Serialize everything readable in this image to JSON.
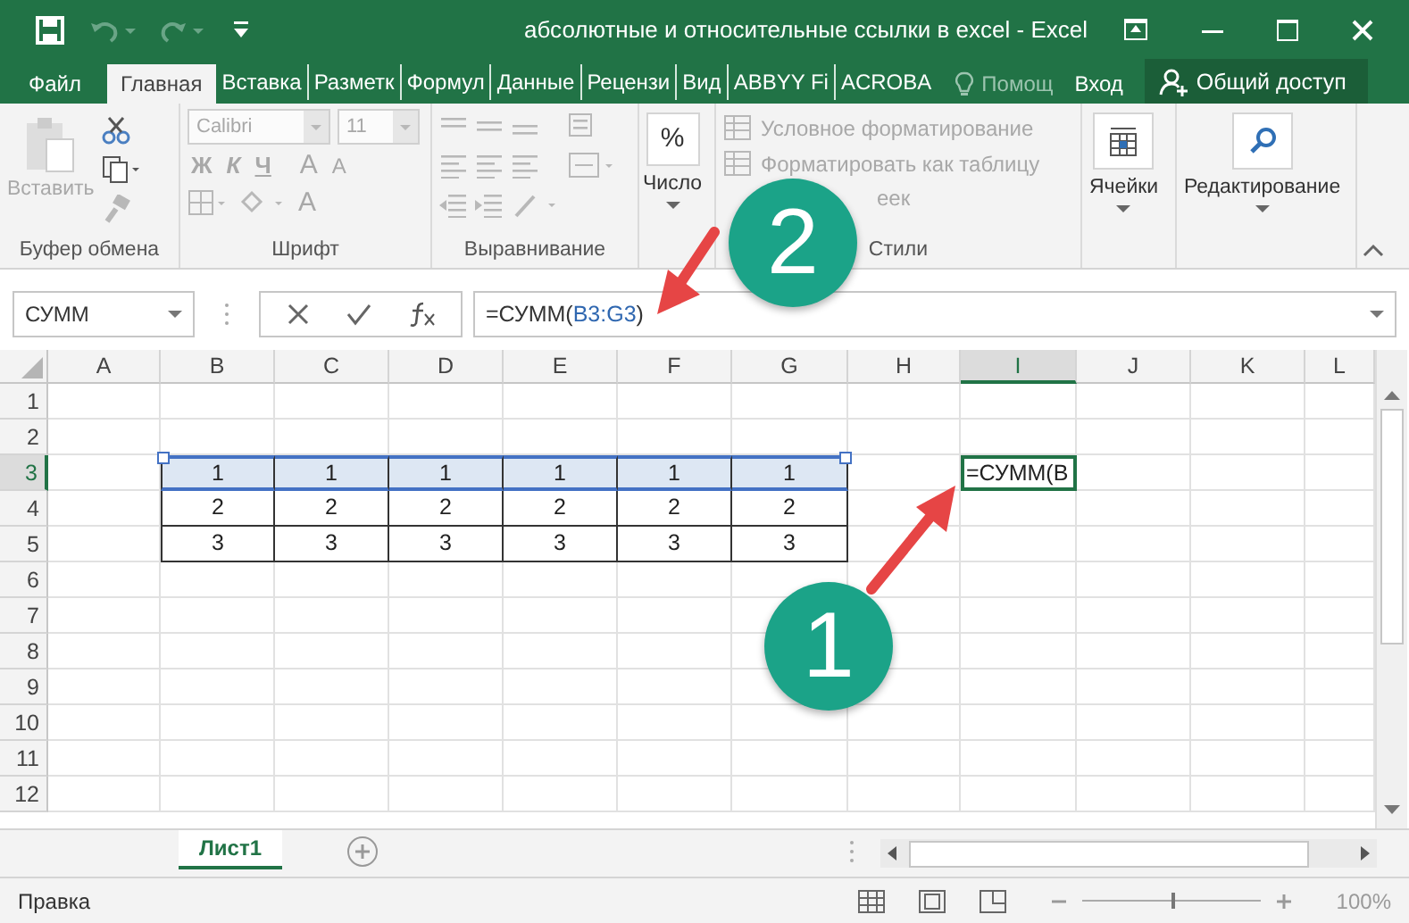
{
  "window": {
    "title": "абсолютные и относительные ссылки в excel - Excel"
  },
  "tabs": [
    {
      "label": "Файл",
      "selected": false
    },
    {
      "label": "Главная",
      "selected": true
    },
    {
      "label": "Вставка",
      "selected": false
    },
    {
      "label": "Разметк",
      "selected": false
    },
    {
      "label": "Формул",
      "selected": false
    },
    {
      "label": "Данные",
      "selected": false
    },
    {
      "label": "Рецензи",
      "selected": false
    },
    {
      "label": "Вид",
      "selected": false
    },
    {
      "label": "ABBYY Fi",
      "selected": false
    },
    {
      "label": "ACROBA",
      "selected": false
    }
  ],
  "tell_me": "Помощ",
  "sign_in": "Вход",
  "share": "Общий доступ",
  "ribbon": [
    {
      "kind": "clipboard",
      "label": "Буфер обмена",
      "button": "Вставить",
      "disabled": true
    },
    {
      "kind": "font",
      "label": "Шрифт",
      "font": "Calibri",
      "size": "11",
      "styles": [
        "Ж",
        "К",
        "Ч"
      ],
      "grow": "A",
      "shrink": "A",
      "font_color_letter": "A",
      "disabled": true
    },
    {
      "kind": "alignment",
      "label": "Выравнивание",
      "disabled": true
    },
    {
      "kind": "number",
      "symbol": "%",
      "button": "Число",
      "disabled": false
    },
    {
      "kind": "styles",
      "label": "Стили",
      "commands": [
        "Условное форматирование",
        "Форматировать как таблицу",
        "еек"
      ],
      "disabled": true
    },
    {
      "kind": "cells",
      "button": "Ячейки",
      "disabled": false
    },
    {
      "kind": "editing",
      "button": "Редактирование",
      "disabled": false
    }
  ],
  "formula_bar": {
    "name_box": "СУММ",
    "formula": [
      {
        "kind": "plain",
        "text": "=СУММ("
      },
      {
        "kind": "ref",
        "text": "B3:G3"
      },
      {
        "kind": "plain",
        "text": ")"
      }
    ]
  },
  "columns": [
    {
      "label": "A",
      "selected": false
    },
    {
      "label": "B",
      "selected": false
    },
    {
      "label": "C",
      "selected": false
    },
    {
      "label": "D",
      "selected": false
    },
    {
      "label": "E",
      "selected": false
    },
    {
      "label": "F",
      "selected": false
    },
    {
      "label": "G",
      "selected": false
    },
    {
      "label": "H",
      "selected": false
    },
    {
      "label": "I",
      "selected": true
    },
    {
      "label": "J",
      "selected": false
    },
    {
      "label": "K",
      "selected": false
    },
    {
      "label": "L",
      "selected": false
    }
  ],
  "rows": [
    {
      "header": "1",
      "selected": false
    },
    {
      "header": "2",
      "selected": false
    },
    {
      "header": "3",
      "selected": true,
      "cells": [
        {},
        {
          "value": "1",
          "bordered": true,
          "selected": true
        },
        {
          "value": "1",
          "bordered": true,
          "selected": true
        },
        {
          "value": "1",
          "bordered": true,
          "selected": true
        },
        {
          "value": "1",
          "bordered": true,
          "selected": true
        },
        {
          "value": "1",
          "bordered": true,
          "selected": true
        },
        {
          "value": "1",
          "bordered": true,
          "selected": true
        },
        {},
        {
          "value": "=СУММ(B",
          "editing": true
        },
        {},
        {},
        {}
      ]
    },
    {
      "header": "4",
      "selected": false,
      "cells": [
        {},
        {
          "value": "2",
          "bordered": true
        },
        {
          "value": "2",
          "bordered": true
        },
        {
          "value": "2",
          "bordered": true
        },
        {
          "value": "2",
          "bordered": true
        },
        {
          "value": "2",
          "bordered": true
        },
        {
          "value": "2",
          "bordered": true
        },
        {},
        {},
        {},
        {},
        {}
      ]
    },
    {
      "header": "5",
      "selected": false,
      "cells": [
        {},
        {
          "value": "3",
          "bordered": true
        },
        {
          "value": "3",
          "bordered": true
        },
        {
          "value": "3",
          "bordered": true
        },
        {
          "value": "3",
          "bordered": true
        },
        {
          "value": "3",
          "bordered": true
        },
        {
          "value": "3",
          "bordered": true
        },
        {},
        {},
        {},
        {},
        {}
      ]
    },
    {
      "header": "6",
      "selected": false
    },
    {
      "header": "7",
      "selected": false
    },
    {
      "header": "8",
      "selected": false
    },
    {
      "header": "9",
      "selected": false
    },
    {
      "header": "10",
      "selected": false
    },
    {
      "header": "11",
      "selected": false
    },
    {
      "header": "12",
      "selected": false
    }
  ],
  "sheets": [
    {
      "label": "Лист1",
      "selected": true
    }
  ],
  "status_bar": {
    "mode": "Правка",
    "zoom": "100%",
    "zoom_level": {
      "level": 0.5
    }
  },
  "annotations": [
    {
      "label": "2"
    },
    {
      "label": "1"
    }
  ]
}
